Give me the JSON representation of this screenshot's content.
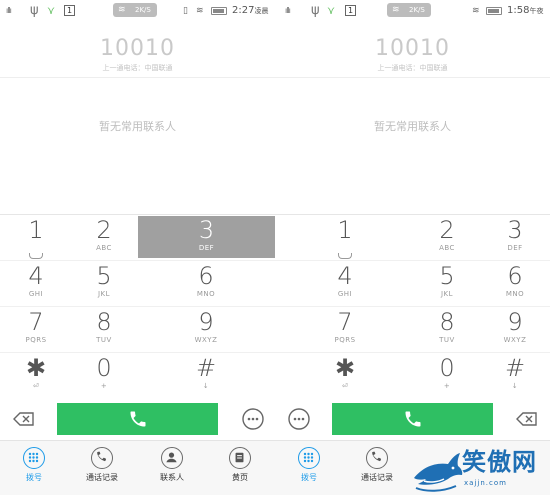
{
  "left": {
    "status": {
      "net_speed": "2K/S",
      "time": "2:27",
      "time_suffix": "凌晨",
      "sim_label": "1"
    },
    "number": "10010",
    "last_call": "上一通电话：中国联通",
    "no_contacts": "暂无常用联系人",
    "keys": [
      {
        "digit": "1",
        "letters": ""
      },
      {
        "digit": "2",
        "letters": "ABC"
      },
      {
        "digit": "3",
        "letters": "DEF"
      },
      {
        "digit": "4",
        "letters": "GHI"
      },
      {
        "digit": "5",
        "letters": "JKL"
      },
      {
        "digit": "6",
        "letters": "MNO"
      },
      {
        "digit": "7",
        "letters": "PQRS"
      },
      {
        "digit": "8",
        "letters": "TUV"
      },
      {
        "digit": "9",
        "letters": "WXYZ"
      },
      {
        "digit": "✱",
        "letters": ""
      },
      {
        "digit": "0",
        "letters": ""
      },
      {
        "digit": "#",
        "letters": ""
      }
    ],
    "highlighted_key": "3",
    "nav": [
      {
        "label": "拨号",
        "icon": "dialpad-icon",
        "active": true
      },
      {
        "label": "通话记录",
        "icon": "phone-log-icon",
        "active": false
      },
      {
        "label": "联系人",
        "icon": "contacts-icon",
        "active": false
      },
      {
        "label": "黄页",
        "icon": "yellow-pages-icon",
        "active": false
      }
    ]
  },
  "right": {
    "status": {
      "net_speed": "2K/S",
      "time": "1:58",
      "time_suffix": "午夜",
      "sim_label": "1"
    },
    "number": "10010",
    "last_call": "上一通电话：中国联通",
    "no_contacts": "暂无常用联系人",
    "keys": [
      {
        "digit": "1",
        "letters": ""
      },
      {
        "digit": "2",
        "letters": "ABC"
      },
      {
        "digit": "3",
        "letters": "DEF"
      },
      {
        "digit": "4",
        "letters": "GHI"
      },
      {
        "digit": "5",
        "letters": "JKL"
      },
      {
        "digit": "6",
        "letters": "MNO"
      },
      {
        "digit": "7",
        "letters": "PQRS"
      },
      {
        "digit": "8",
        "letters": "TUV"
      },
      {
        "digit": "9",
        "letters": "WXYZ"
      },
      {
        "digit": "✱",
        "letters": ""
      },
      {
        "digit": "0",
        "letters": ""
      },
      {
        "digit": "#",
        "letters": ""
      }
    ],
    "nav": [
      {
        "label": "拨号",
        "icon": "dialpad-icon",
        "active": true
      },
      {
        "label": "通话记录",
        "icon": "phone-log-icon",
        "active": false
      }
    ]
  },
  "watermark": {
    "text": "笑傲网",
    "url": "xajjn.com"
  },
  "colors": {
    "call_green": "#2fbf63",
    "active_blue": "#1e9be8",
    "highlight_gray": "#a0a0a0"
  }
}
